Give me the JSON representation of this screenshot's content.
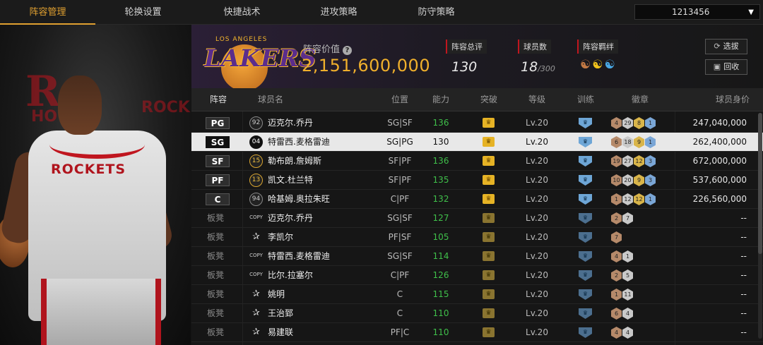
{
  "nav": {
    "tabs": [
      "阵容管理",
      "轮换设置",
      "快捷战术",
      "进攻策略",
      "防守策略"
    ],
    "active_index": 0,
    "user_id": "1213456"
  },
  "hero": {
    "team_logo_text": "ROCKETS",
    "side_text_left": "HOU",
    "side_text_right": "ROCK"
  },
  "team": {
    "logo_name": "LAKERS",
    "logo_city": "LOS ANGELES",
    "value_label": "阵容价值",
    "value": "2,151,600,000",
    "rating_label": "阵容总评",
    "rating": "130",
    "players_label": "球员数",
    "players_count": "18",
    "players_max": "/300",
    "bond_label": "阵容羁绊",
    "buttons": {
      "select": "选拔",
      "recycle": "回收"
    }
  },
  "table": {
    "headers": [
      "阵容",
      "球员名",
      "位置",
      "能力",
      "突破",
      "等级",
      "训练",
      "徽章",
      "球员身价"
    ],
    "rows": [
      {
        "slot": "PG",
        "num": "92",
        "numtype": "plain",
        "name": "迈克尔.乔丹",
        "pos": "SG|SF",
        "ability": "136",
        "level": "Lv.20",
        "badges": [
          [
            "b",
            "4"
          ],
          [
            "s",
            "29"
          ],
          [
            "g",
            "8"
          ],
          [
            "d",
            "1"
          ]
        ],
        "price": "247,040,000"
      },
      {
        "slot": "SG",
        "num": "04",
        "numtype": "plain",
        "name": "特雷西.麦格雷迪",
        "pos": "SG|PG",
        "ability": "130",
        "level": "Lv.20",
        "badges": [
          [
            "b",
            "6"
          ],
          [
            "s",
            "18"
          ],
          [
            "g",
            "9"
          ],
          [
            "d",
            "1"
          ]
        ],
        "price": "262,400,000",
        "selected": true
      },
      {
        "slot": "SF",
        "num": "15",
        "numtype": "gold",
        "name": "勒布朗.詹姆斯",
        "pos": "SF|PF",
        "ability": "136",
        "level": "Lv.20",
        "badges": [
          [
            "b",
            "19"
          ],
          [
            "s",
            "27"
          ],
          [
            "g",
            "12"
          ],
          [
            "d",
            "3"
          ]
        ],
        "price": "672,000,000"
      },
      {
        "slot": "PF",
        "num": "13",
        "numtype": "gold",
        "name": "凯文.杜兰特",
        "pos": "SF|PF",
        "ability": "135",
        "level": "Lv.20",
        "badges": [
          [
            "b",
            "10"
          ],
          [
            "s",
            "20"
          ],
          [
            "g",
            "9"
          ],
          [
            "d",
            "3"
          ]
        ],
        "price": "537,600,000"
      },
      {
        "slot": "C",
        "num": "94",
        "numtype": "plain",
        "name": "哈基姆.奥拉朱旺",
        "pos": "C|PF",
        "ability": "132",
        "level": "Lv.20",
        "badges": [
          [
            "b",
            "1"
          ],
          [
            "s",
            "12"
          ],
          [
            "g",
            "12"
          ],
          [
            "d",
            "1"
          ]
        ],
        "price": "226,560,000"
      },
      {
        "slot": "板凳",
        "num": "COPY",
        "numtype": "copy",
        "name": "迈克尔.乔丹",
        "pos": "SG|SF",
        "ability": "127",
        "level": "Lv.20",
        "badges": [
          [
            "b",
            "2"
          ],
          [
            "s",
            "7"
          ]
        ],
        "price": "--"
      },
      {
        "slot": "板凳",
        "num": "✰",
        "numtype": "star",
        "name": "李凯尔",
        "pos": "PF|SF",
        "ability": "105",
        "level": "Lv.20",
        "badges": [
          [
            "b",
            "7"
          ]
        ],
        "price": "--"
      },
      {
        "slot": "板凳",
        "num": "COPY",
        "numtype": "copy",
        "name": "特雷西.麦格雷迪",
        "pos": "SG|SF",
        "ability": "114",
        "level": "Lv.20",
        "badges": [
          [
            "b",
            "4"
          ],
          [
            "s",
            "1"
          ]
        ],
        "price": "--"
      },
      {
        "slot": "板凳",
        "num": "COPY",
        "numtype": "copy",
        "name": "比尔.拉塞尔",
        "pos": "C|PF",
        "ability": "126",
        "level": "Lv.20",
        "badges": [
          [
            "b",
            "2"
          ],
          [
            "s",
            "5"
          ]
        ],
        "price": "--"
      },
      {
        "slot": "板凳",
        "num": "✰",
        "numtype": "star",
        "name": "姚明",
        "pos": "C",
        "ability": "115",
        "level": "Lv.20",
        "badges": [
          [
            "b",
            "1"
          ],
          [
            "s",
            "11"
          ]
        ],
        "price": "--"
      },
      {
        "slot": "板凳",
        "num": "✰",
        "numtype": "star",
        "name": "王治郅",
        "pos": "C",
        "ability": "110",
        "level": "Lv.20",
        "badges": [
          [
            "b",
            "6"
          ],
          [
            "s",
            "4"
          ]
        ],
        "price": "--"
      },
      {
        "slot": "板凳",
        "num": "✰",
        "numtype": "star",
        "name": "易建联",
        "pos": "PF|C",
        "ability": "110",
        "level": "Lv.20",
        "badges": [
          [
            "b",
            "4"
          ],
          [
            "s",
            "4"
          ]
        ],
        "price": "--"
      }
    ]
  }
}
